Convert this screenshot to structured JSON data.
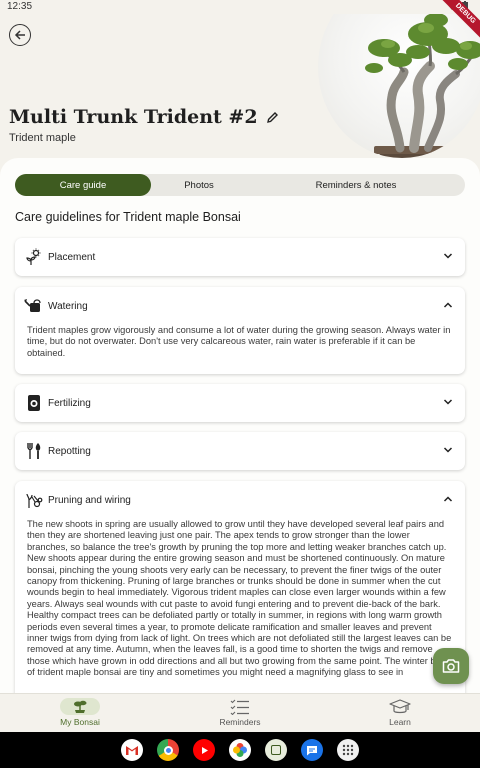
{
  "status_bar": {
    "time": "12:35",
    "ribbon": "DEBUG"
  },
  "header": {
    "title": "Multi Trunk Trident #2",
    "subtitle": "Trident maple"
  },
  "tabs": [
    {
      "label": "Care guide",
      "active": true
    },
    {
      "label": "Photos",
      "active": false
    },
    {
      "label": "Reminders & notes",
      "active": false
    }
  ],
  "care_title": "Care guidelines for Trident maple Bonsai",
  "sections": {
    "placement": {
      "label": "Placement",
      "icon": "sun-plant-icon",
      "expanded": false
    },
    "watering": {
      "label": "Watering",
      "icon": "watering-can-icon",
      "expanded": true,
      "text": "Trident maples grow vigorously and consume a lot of water during the growing season. Always water in time, but do not overwater. Don't use very calcareous water, rain water is preferable if it can be obtained."
    },
    "fertilizing": {
      "label": "Fertilizing",
      "icon": "fertilizer-bag-icon",
      "expanded": false
    },
    "repotting": {
      "label": "Repotting",
      "icon": "fork-trowel-icon",
      "expanded": false
    },
    "pruning": {
      "label": "Pruning and wiring",
      "icon": "pruning-icon",
      "expanded": true,
      "text": "The new shoots in spring are usually allowed to grow until they have developed several leaf pairs and then they are shortened leaving just one pair. The apex tends to grow stronger than the lower branches, so balance the tree's growth by pruning the top more and letting weaker branches catch up. New shoots appear during the entire growing season and must be shortened continuously. On mature bonsai, pinching the young shoots very early can be necessary, to prevent the finer twigs of the outer canopy from thickening. Pruning of large branches or trunks should be done in summer when the cut wounds begin to heal immediately. Vigorous trident maples can close even larger wounds within a few years. Always seal wounds with cut paste to avoid fungi entering and to prevent die-back of the bark. Healthy compact trees can be defoliated partly or totally in summer, in regions with long warm growth periods even several times a year, to promote delicate ramification and smaller leaves and prevent inner twigs from dying from lack of light. On trees which are not defoliated still the largest leaves can be removed at any time. Autumn, when the leaves fall, is a good time to shorten the twigs and remove those which have grown in odd directions and all but two growing from the same point. The winter buds of trident maple bonsai are tiny and sometimes you might need a magnifying glass to see in"
    }
  },
  "fab": {
    "icon": "camera-icon"
  },
  "bottom_nav": [
    {
      "label": "My Bonsai",
      "icon": "bonsai-icon",
      "active": true
    },
    {
      "label": "Reminders",
      "icon": "checklist-icon",
      "active": false
    },
    {
      "label": "Learn",
      "icon": "graduation-cap-icon",
      "active": false
    }
  ],
  "taskbar_apps": [
    "gmail-icon",
    "chrome-icon",
    "youtube-icon",
    "photos-icon",
    "app-icon",
    "messages-icon",
    "app-drawer-icon"
  ],
  "colors": {
    "primary": "#3e5b20",
    "fab": "#6f9150",
    "background": "#f4f2ec"
  }
}
